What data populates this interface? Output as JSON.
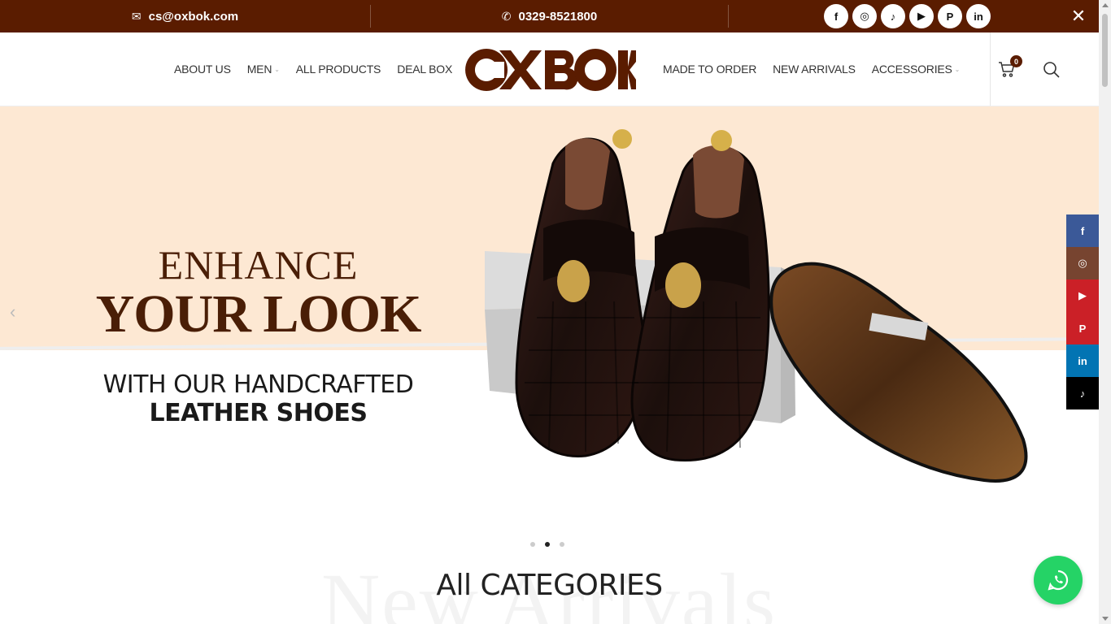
{
  "topbar": {
    "email": "cs@oxbok.com",
    "phone": "0329-8521800",
    "social_icons": [
      "facebook-icon",
      "instagram-icon",
      "tiktok-icon",
      "youtube-icon",
      "pinterest-icon",
      "linkedin-icon"
    ],
    "close_icon": "close-icon",
    "background": "#5a1c00"
  },
  "brand": {
    "logo_text": "OXBOK",
    "color": "#5a1c00"
  },
  "nav": {
    "left": [
      {
        "label": "ABOUT US",
        "dropdown": false
      },
      {
        "label": "MEN",
        "dropdown": true
      },
      {
        "label": "ALL PRODUCTS",
        "dropdown": false
      },
      {
        "label": "DEAL BOX",
        "dropdown": false
      }
    ],
    "right": [
      {
        "label": "MADE TO ORDER",
        "dropdown": false
      },
      {
        "label": "NEW ARRIVALS",
        "dropdown": false
      },
      {
        "label": "ACCESSORIES",
        "dropdown": true
      }
    ]
  },
  "cart": {
    "count": "0"
  },
  "hero": {
    "line1": "ENHANCE",
    "line2": "YOUR LOOK",
    "line3": "WITH OUR HANDCRAFTED",
    "line4": "LEATHER SHOES",
    "slides": 3,
    "active_slide": 2,
    "band_color": "#fde8d3"
  },
  "section": {
    "watermark": "New Arrivals",
    "title": "All CATEGORIES"
  },
  "floating_social": [
    {
      "icon": "facebook-icon",
      "glyph": "f",
      "color": "#3b5998"
    },
    {
      "icon": "instagram-icon",
      "glyph": "◎",
      "color": "#774430"
    },
    {
      "icon": "youtube-icon",
      "glyph": "▶",
      "color": "#cb2027"
    },
    {
      "icon": "pinterest-icon",
      "glyph": "P",
      "color": "#cb2027"
    },
    {
      "icon": "linkedin-icon",
      "glyph": "in",
      "color": "#0274b3"
    },
    {
      "icon": "tiktok-icon",
      "glyph": "♪",
      "color": "#000000"
    }
  ],
  "whatsapp": {
    "icon": "whatsapp-icon",
    "color": "#25d366"
  }
}
